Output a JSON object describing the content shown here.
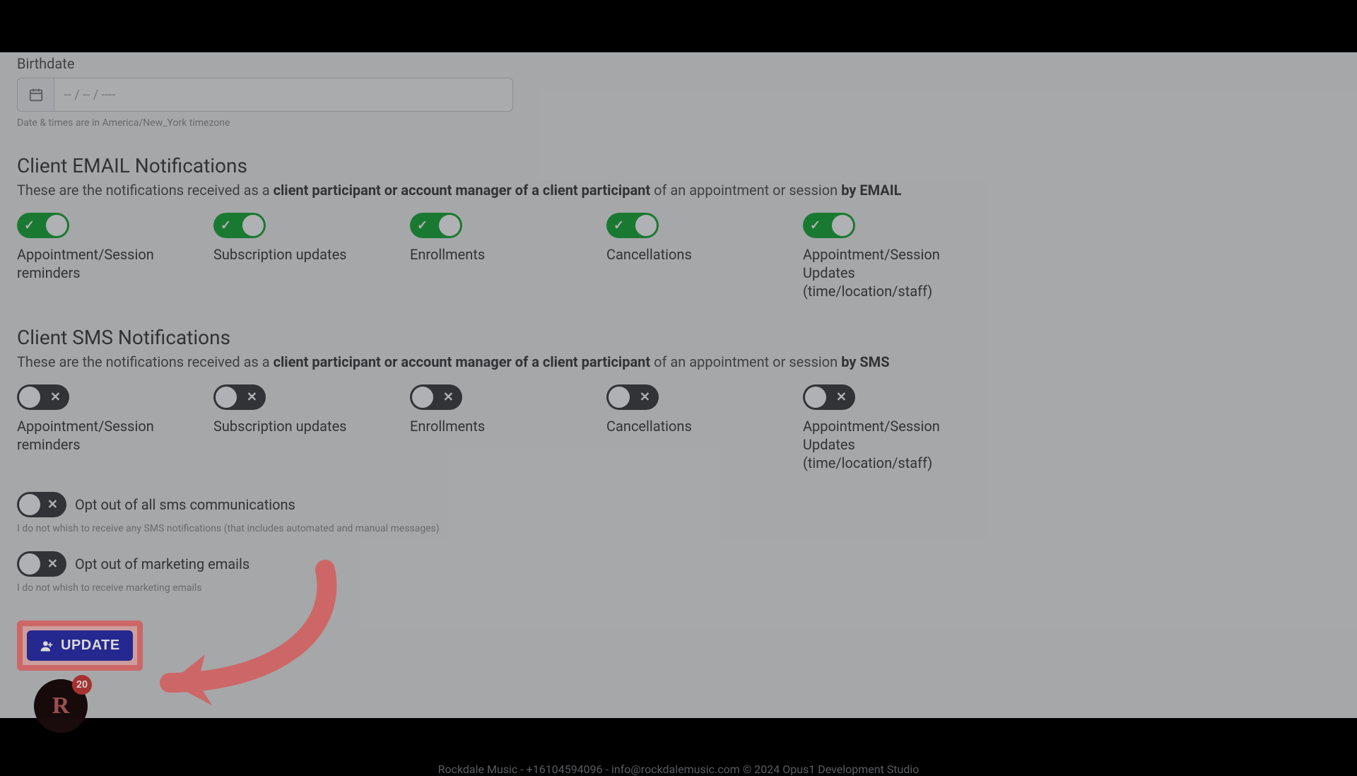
{
  "birthdate": {
    "label": "Birthdate",
    "placeholder": "--  / --  / ----",
    "tz_note": "Date & times are in America/New_York timezone"
  },
  "email_section": {
    "title": "Client EMAIL Notifications",
    "desc_prefix": "These are the notifications received as a ",
    "desc_bold": "client participant or account manager of a client participant",
    "desc_mid": " of an appointment or session ",
    "desc_suffix_bold": "by EMAIL"
  },
  "email_toggles": [
    {
      "label": "Appointment/Session reminders",
      "on": true
    },
    {
      "label": "Subscription updates",
      "on": true
    },
    {
      "label": "Enrollments",
      "on": true
    },
    {
      "label": "Cancellations",
      "on": true
    },
    {
      "label": "Appointment/Session Updates (time/location/staff)",
      "on": true
    }
  ],
  "sms_section": {
    "title": "Client SMS Notifications",
    "desc_prefix": "These are the notifications received as a ",
    "desc_bold": "client participant or account manager of a client participant",
    "desc_mid": " of an appointment or session ",
    "desc_suffix_bold": "by SMS"
  },
  "sms_toggles": [
    {
      "label": "Appointment/Session reminders",
      "on": false
    },
    {
      "label": "Subscription updates",
      "on": false
    },
    {
      "label": "Enrollments",
      "on": false
    },
    {
      "label": "Cancellations",
      "on": false
    },
    {
      "label": "Appointment/Session Updates (time/location/staff)",
      "on": false
    }
  ],
  "opt_sms": {
    "label": "Opt out of all sms communications",
    "note": "I do not whish to receive any SMS notifications (that includes automated and manual messages)",
    "on": false
  },
  "opt_marketing": {
    "label": "Opt out of marketing emails",
    "note": "I do not whish to receive marketing emails",
    "on": false
  },
  "update_button": "UPDATE",
  "avatar": {
    "initial": "R",
    "badge": "20"
  },
  "footer": {
    "org": "Rockdale Music",
    "sep": "  -  ",
    "phone": "+16104594096",
    "email": "info@rockdalemusic.com",
    "copyright": " © 2024 Opus1 Development Studio"
  }
}
